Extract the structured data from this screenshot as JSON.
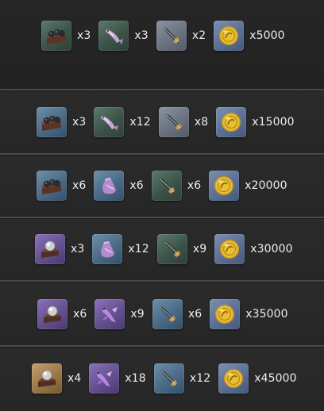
{
  "reward_rows": [
    {
      "items": [
        {
          "icon": "cannon-ammo-crate-icon",
          "rarity": "green",
          "quantity": "x3"
        },
        {
          "icon": "purple-fish-icon",
          "rarity": "green",
          "quantity": "x3"
        },
        {
          "icon": "spear-blade-icon",
          "rarity": "grey",
          "quantity": "x2"
        },
        {
          "icon": "gold-coin-icon",
          "rarity": "coin",
          "quantity": "x5000"
        }
      ]
    },
    {
      "items": [
        {
          "icon": "cannon-ammo-crate-icon",
          "rarity": "blue",
          "quantity": "x3"
        },
        {
          "icon": "purple-fish-icon",
          "rarity": "green",
          "quantity": "x12"
        },
        {
          "icon": "spear-blade-icon",
          "rarity": "grey",
          "quantity": "x8"
        },
        {
          "icon": "gold-coin-icon",
          "rarity": "coin",
          "quantity": "x15000"
        }
      ]
    },
    {
      "items": [
        {
          "icon": "cannon-ammo-crate-icon",
          "rarity": "blue",
          "quantity": "x6"
        },
        {
          "icon": "purple-pouch-icon",
          "rarity": "blue",
          "quantity": "x6"
        },
        {
          "icon": "spear-blade-icon",
          "rarity": "green",
          "quantity": "x6"
        },
        {
          "icon": "gold-coin-icon",
          "rarity": "coin",
          "quantity": "x20000"
        }
      ]
    },
    {
      "items": [
        {
          "icon": "pearl-on-stand-icon",
          "rarity": "purple",
          "quantity": "x3"
        },
        {
          "icon": "purple-pouch-icon",
          "rarity": "blue",
          "quantity": "x12"
        },
        {
          "icon": "spear-blade-icon",
          "rarity": "green",
          "quantity": "x9"
        },
        {
          "icon": "gold-coin-icon",
          "rarity": "coin",
          "quantity": "x30000"
        }
      ]
    },
    {
      "items": [
        {
          "icon": "pearl-on-stand-icon",
          "rarity": "purple",
          "quantity": "x6"
        },
        {
          "icon": "purple-creature-icon",
          "rarity": "purple",
          "quantity": "x9"
        },
        {
          "icon": "spear-blade-icon",
          "rarity": "blue",
          "quantity": "x6"
        },
        {
          "icon": "gold-coin-icon",
          "rarity": "coin",
          "quantity": "x35000"
        }
      ]
    },
    {
      "items": [
        {
          "icon": "pearl-on-stand-icon",
          "rarity": "gold",
          "quantity": "x4"
        },
        {
          "icon": "purple-creature-icon",
          "rarity": "purple",
          "quantity": "x18"
        },
        {
          "icon": "spear-blade-icon",
          "rarity": "blue",
          "quantity": "x12"
        },
        {
          "icon": "gold-coin-icon",
          "rarity": "coin",
          "quantity": "x45000"
        }
      ]
    }
  ]
}
